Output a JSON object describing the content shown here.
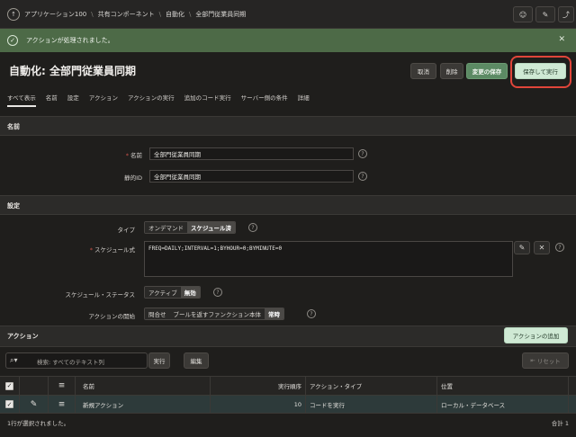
{
  "breadcrumb": {
    "app": "アプリケーション100",
    "shared": "共有コンポーネント",
    "automation": "自動化",
    "current": "全部門従業員同期"
  },
  "success_message": "アクションが処理されました。",
  "page_title": "自動化: 全部門従業員同期",
  "buttons": {
    "cancel": "取消",
    "delete": "削除",
    "save_changes": "変更の保存",
    "save_and_run": "保存して実行",
    "add_action": "アクションの追加",
    "go": "実行",
    "edit": "編集",
    "reset": "リセット"
  },
  "tabs": [
    "すべて表示",
    "名前",
    "設定",
    "アクション",
    "アクションの実行",
    "追加のコード実行",
    "サーバー側の条件",
    "詳細"
  ],
  "sections": {
    "name": "名前",
    "settings": "設定",
    "actions": "アクション"
  },
  "form": {
    "name_label": "名前",
    "name_value": "全部門従業員同期",
    "static_id_label": "静的ID",
    "static_id_value": "全部門従業員同期",
    "type_label": "タイプ",
    "type_options": [
      "オンデマンド",
      "スケジュール済"
    ],
    "schedule_label": "スケジュール式",
    "schedule_value": "FREQ=DAILY;INTERVAL=1;BYHOUR=0;BYMINUTE=0",
    "status_label": "スケジュール・ステータス",
    "status_options": [
      "アクティブ",
      "無効"
    ],
    "start_label": "アクションの開始",
    "start_options": [
      "問合せ",
      "ブールを返すファンクション本体",
      "常時"
    ]
  },
  "search": {
    "placeholder": "検索: すべてのテキスト列"
  },
  "table": {
    "headers": {
      "name": "名前",
      "order": "実行順序",
      "action_type": "アクション・タイプ",
      "location": "位置"
    },
    "rows": [
      {
        "name": "新規アクション",
        "order": "10",
        "action_type": "コードを実行",
        "location": "ローカル・データベース"
      }
    ]
  },
  "footer": {
    "selected": "1行が選択されました。",
    "total": "合計 1"
  },
  "colors": {
    "success_bg": "#4d6a47",
    "save_button": "#5c8a64",
    "save_run_button": "#cfe9d4",
    "highlight": "#e0453a",
    "required": "#c9524a"
  }
}
